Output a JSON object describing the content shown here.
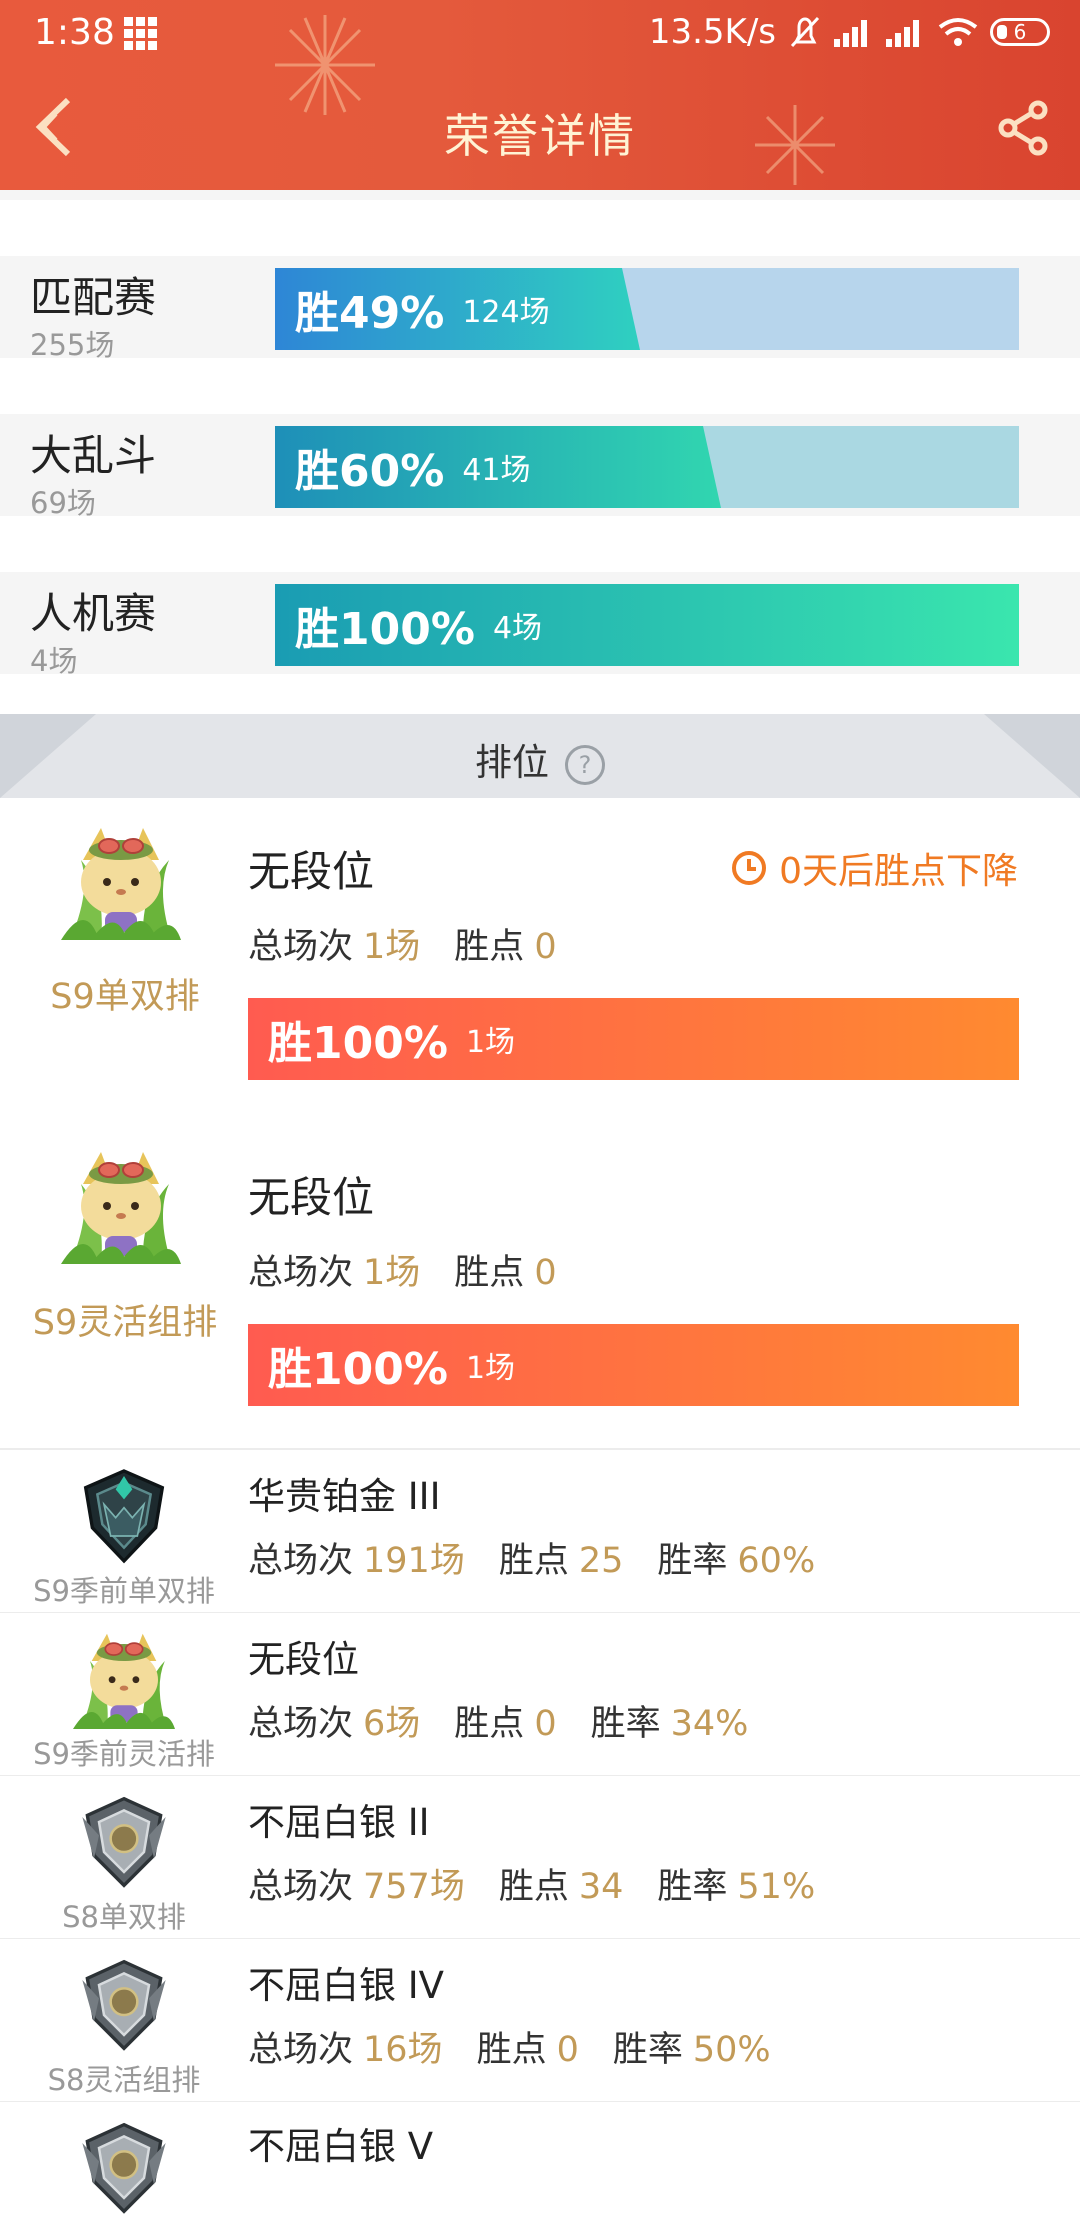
{
  "status_bar": {
    "time": "1:38",
    "net_speed": "13.5K/s",
    "battery": "6"
  },
  "header": {
    "title": "荣誉详情"
  },
  "modes": [
    {
      "name": "匹配赛",
      "count": "255场",
      "win_pct_label": "胜49%",
      "games": "124场",
      "win_rate": 0.49,
      "fill_from": "#2e86d6",
      "fill_to": "#2fd0c0",
      "rest_color": "#b7d5ec"
    },
    {
      "name": "大乱斗",
      "count": "69场",
      "win_pct_label": "胜60%",
      "games": "41场",
      "win_rate": 0.6,
      "fill_from": "#1e8fb8",
      "fill_to": "#31d6b0",
      "rest_color": "#aad8e2"
    },
    {
      "name": "人机赛",
      "count": "4场",
      "win_pct_label": "胜100%",
      "games": "4场",
      "win_rate": 1.0,
      "fill_from": "#1a9cb3",
      "fill_to": "#3ae6ae",
      "rest_color": "#a9e6da"
    }
  ],
  "rank_section": {
    "title": "排位",
    "help_glyph": "?"
  },
  "ranked_cards": [
    {
      "queue": "S9单双排",
      "tier": "无段位",
      "decay": "0天后胜点下降",
      "games_label": "总场次",
      "games": "1场",
      "lp_label": "胜点",
      "lp": "0",
      "win_pct_label": "胜100%",
      "win_games": "1场"
    },
    {
      "queue": "S9灵活组排",
      "tier": "无段位",
      "games_label": "总场次",
      "games": "1场",
      "lp_label": "胜点",
      "lp": "0",
      "win_pct_label": "胜100%",
      "win_games": "1场"
    }
  ],
  "ranked_rows": [
    {
      "queue": "S9季前单双排",
      "tier": "华贵铂金 III",
      "games_label": "总场次",
      "games": "191场",
      "lp_label": "胜点",
      "lp": "25",
      "rate_label": "胜率",
      "rate": "60%",
      "emblem": "platinum"
    },
    {
      "queue": "S9季前灵活排",
      "tier": "无段位",
      "games_label": "总场次",
      "games": "6场",
      "lp_label": "胜点",
      "lp": "0",
      "rate_label": "胜率",
      "rate": "34%",
      "emblem": "teemo"
    },
    {
      "queue": "S8单双排",
      "tier": "不屈白银 II",
      "games_label": "总场次",
      "games": "757场",
      "lp_label": "胜点",
      "lp": "34",
      "rate_label": "胜率",
      "rate": "51%",
      "emblem": "silver"
    },
    {
      "queue": "S8灵活组排",
      "tier": "不屈白银 IV",
      "games_label": "总场次",
      "games": "16场",
      "lp_label": "胜点",
      "lp": "0",
      "rate_label": "胜率",
      "rate": "50%",
      "emblem": "silver"
    },
    {
      "queue": "",
      "tier": "不屈白银 V",
      "emblem": "silver"
    }
  ],
  "colors": {
    "header_red": "#e45a3c",
    "gold_value": "#c29a57",
    "decay_orange": "#f07a23"
  }
}
